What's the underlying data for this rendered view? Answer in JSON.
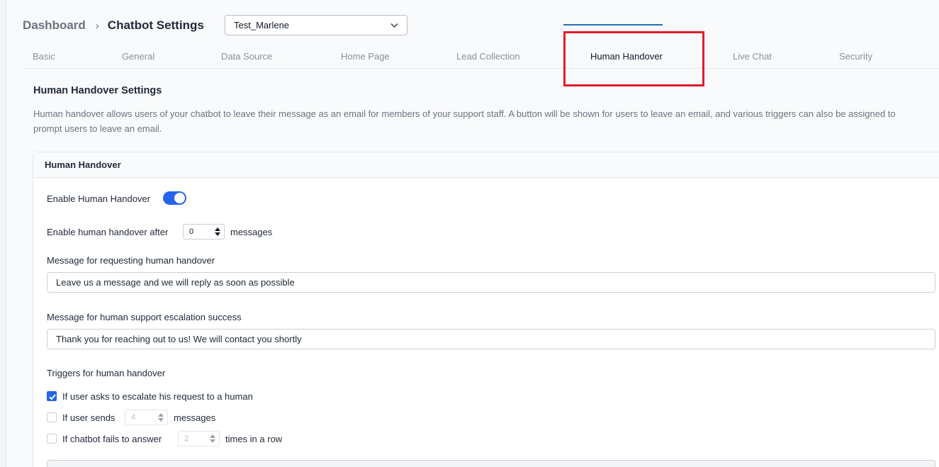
{
  "breadcrumb": {
    "root": "Dashboard",
    "separator": "›",
    "current": "Chatbot Settings"
  },
  "bot_selector": {
    "value": "Test_Marlene"
  },
  "tabs": [
    {
      "label": "Basic"
    },
    {
      "label": "General"
    },
    {
      "label": "Data Source"
    },
    {
      "label": "Home Page"
    },
    {
      "label": "Lead Collection"
    },
    {
      "label": "Human Handover",
      "active": true
    },
    {
      "label": "Live Chat"
    },
    {
      "label": "Security"
    }
  ],
  "section": {
    "title": "Human Handover Settings",
    "description": "Human handover allows users of your chatbot to leave their message as an email for members of your support staff. A button will be shown for users to leave an email, and various triggers can also be assigned to prompt users to leave an email."
  },
  "card": {
    "header": "Human Handover",
    "enable_label": "Enable Human Handover",
    "enable_on": true,
    "after_prefix": "Enable human handover after",
    "after_value": "0",
    "after_suffix": "messages",
    "request_label": "Message for requesting human handover",
    "request_value": "Leave us a message and we will reply as soon as possible",
    "success_label": "Message for human support escalation success",
    "success_value": "Thank you for reaching out to us! We will contact you shortly",
    "triggers_label": "Triggers for human handover",
    "triggers": {
      "escalate_label": "If user asks to escalate his request to a human",
      "escalate_checked": true,
      "sends_prefix": "If user sends",
      "sends_value": "4",
      "sends_suffix": "messages",
      "fails_prefix": "If chatbot fails to answer",
      "fails_value": "2",
      "fails_suffix": "times in a row"
    }
  },
  "colors": {
    "accent": "#2563eb",
    "highlight": "#e11d2a",
    "tab_underline": "#2b6cb0"
  }
}
